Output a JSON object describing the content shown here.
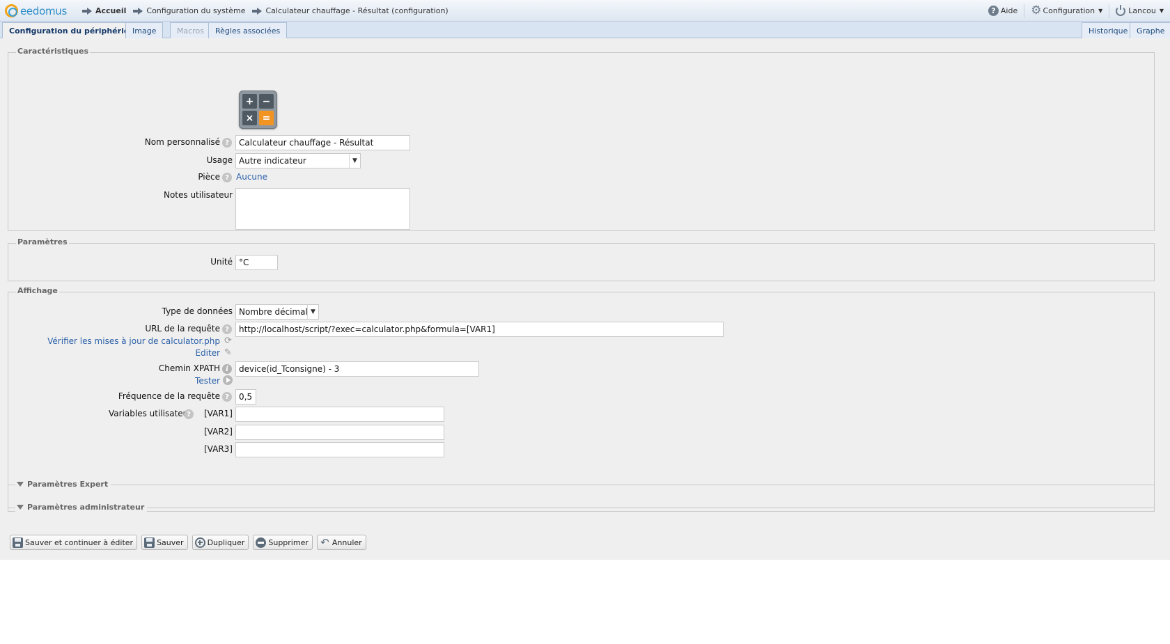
{
  "header": {
    "logo_text": "eedomus",
    "breadcrumb": [
      "Accueil",
      "Configuration du système",
      "Calculateur chauffage - Résultat (configuration)"
    ],
    "help_label": "Aide",
    "config_label": "Configuration",
    "user_label": "Lancou"
  },
  "tabs": {
    "left": [
      "Configuration du périphérique",
      "Image",
      "Macros",
      "Règles associées"
    ],
    "right": [
      "Historique",
      "Graphe"
    ],
    "active": "Configuration du périphérique",
    "disabled": "Macros"
  },
  "caracteristiques": {
    "legend": "Caractéristiques",
    "icon_name": "calculator-icon",
    "calc_keys": [
      "+",
      "−",
      "×",
      "="
    ],
    "nom_label": "Nom personnalisé",
    "nom_value": "Calculateur chauffage - Résultat",
    "usage_label": "Usage",
    "usage_value": "Autre indicateur",
    "piece_label": "Pièce",
    "piece_value": "Aucune",
    "notes_label": "Notes utilisateur",
    "notes_value": ""
  },
  "parametres": {
    "legend": "Paramètres",
    "unite_label": "Unité",
    "unite_value": "°C"
  },
  "affichage": {
    "legend": "Affichage",
    "type_label": "Type de données",
    "type_value": "Nombre décimal",
    "url_label": "URL de la requête",
    "url_value": "http://localhost/script/?exec=calculator.php&formula=[VAR1]",
    "verify_link": "Vérifier les mises à jour de calculator.php",
    "edit_link": "Editer",
    "xpath_label": "Chemin XPATH",
    "xpath_value": "device(id_Tconsigne) - 3",
    "test_link": "Tester",
    "freq_label": "Fréquence de la requête",
    "freq_value": "0,5",
    "vars_label": "Variables utilisateur",
    "var1_label": "[VAR1]",
    "var2_label": "[VAR2]",
    "var3_label": "[VAR3]",
    "var1_value": "",
    "var2_value": "",
    "var3_value": ""
  },
  "sections": {
    "expert": "Paramètres Expert",
    "admin": "Paramètres administrateur"
  },
  "buttons": {
    "save_continue": "Sauver et continuer à éditer",
    "save": "Sauver",
    "duplicate": "Dupliquer",
    "delete": "Supprimer",
    "cancel": "Annuler"
  },
  "colors": {
    "accent": "#2d8dc8",
    "link": "#2a5fa8",
    "calc_equal": "#f29422"
  }
}
